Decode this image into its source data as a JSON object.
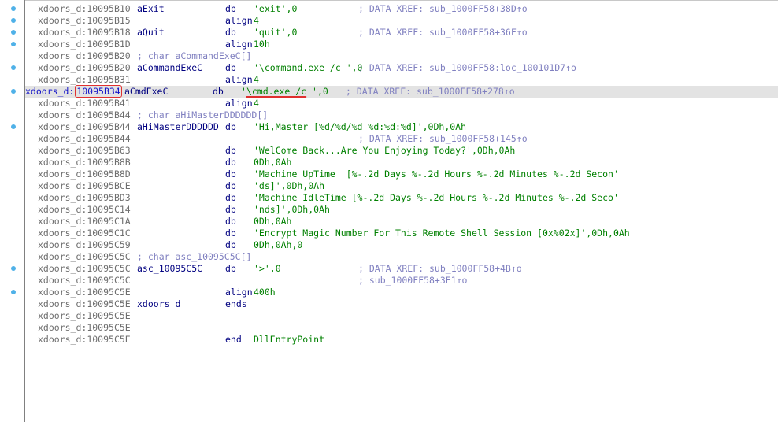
{
  "lines": [
    {
      "seg": "xdoors_d",
      "addr": "10095B10",
      "label": "aExit",
      "mnem": "db",
      "ops": "'exit',0",
      "cmt": "; DATA XREF: sub_1000FF58+38D↑o"
    },
    {
      "seg": "xdoors_d",
      "addr": "10095B15",
      "label": "",
      "mnem": "align",
      "ops": "4",
      "cmt": ""
    },
    {
      "seg": "xdoors_d",
      "addr": "10095B18",
      "label": "aQuit",
      "mnem": "db",
      "ops": "'quit',0",
      "cmt": "; DATA XREF: sub_1000FF58+36F↑o"
    },
    {
      "seg": "xdoors_d",
      "addr": "10095B1D",
      "label": "",
      "mnem": "align",
      "ops": "10h",
      "cmt": ""
    },
    {
      "seg": "xdoors_d",
      "addr": "10095B20",
      "decl": "; char aCommandExeC[]"
    },
    {
      "seg": "xdoors_d",
      "addr": "10095B20",
      "label": "aCommandExeC",
      "mnem": "db",
      "ops": "'\\command.exe /c ',0",
      "cmt": "; DATA XREF: sub_1000FF58:loc_100101D7↑o"
    },
    {
      "seg": "xdoors_d",
      "addr": "10095B31",
      "label": "",
      "mnem": "align",
      "ops": "4",
      "cmt": ""
    },
    {
      "seg": "xdoors_d",
      "addr": "10095B34",
      "label": "aCmdExeC",
      "mnem": "db",
      "ops_pre": "'",
      "ops_ul": "\\cmd.exe /c",
      "ops_post": " ',0",
      "cmt": "; DATA XREF: sub_1000FF58+278↑o",
      "current": true
    },
    {
      "seg": "xdoors_d",
      "addr": "10095B41",
      "label": "",
      "mnem": "align",
      "ops": "4",
      "cmt": ""
    },
    {
      "seg": "xdoors_d",
      "addr": "10095B44",
      "decl": "; char aHiMasterDDDDDD[]"
    },
    {
      "seg": "xdoors_d",
      "addr": "10095B44",
      "label": "aHiMasterDDDDDD",
      "mnem": "db",
      "ops": "'Hi,Master [%d/%d/%d %d:%d:%d]',0Dh,0Ah",
      "cmt": ""
    },
    {
      "seg": "xdoors_d",
      "addr": "10095B44",
      "label": "",
      "mnem": "",
      "ops": "",
      "cmt": "; DATA XREF: sub_1000FF58+145↑o"
    },
    {
      "seg": "xdoors_d",
      "addr": "10095B63",
      "label": "",
      "mnem": "db",
      "ops": "'WelCome Back...Are You Enjoying Today?',0Dh,0Ah",
      "cmt": ""
    },
    {
      "seg": "xdoors_d",
      "addr": "10095B8B",
      "label": "",
      "mnem": "db",
      "ops": "0Dh,0Ah",
      "cmt": ""
    },
    {
      "seg": "xdoors_d",
      "addr": "10095B8D",
      "label": "",
      "mnem": "db",
      "ops": "'Machine UpTime  [%-.2d Days %-.2d Hours %-.2d Minutes %-.2d Secon'",
      "cmt": ""
    },
    {
      "seg": "xdoors_d",
      "addr": "10095BCE",
      "label": "",
      "mnem": "db",
      "ops": "'ds]',0Dh,0Ah",
      "cmt": ""
    },
    {
      "seg": "xdoors_d",
      "addr": "10095BD3",
      "label": "",
      "mnem": "db",
      "ops": "'Machine IdleTime [%-.2d Days %-.2d Hours %-.2d Minutes %-.2d Seco'",
      "cmt": ""
    },
    {
      "seg": "xdoors_d",
      "addr": "10095C14",
      "label": "",
      "mnem": "db",
      "ops": "'nds]',0Dh,0Ah",
      "cmt": ""
    },
    {
      "seg": "xdoors_d",
      "addr": "10095C1A",
      "label": "",
      "mnem": "db",
      "ops": "0Dh,0Ah",
      "cmt": ""
    },
    {
      "seg": "xdoors_d",
      "addr": "10095C1C",
      "label": "",
      "mnem": "db",
      "ops": "'Encrypt Magic Number For This Remote Shell Session [0x%02x]',0Dh,0Ah",
      "cmt": ""
    },
    {
      "seg": "xdoors_d",
      "addr": "10095C59",
      "label": "",
      "mnem": "db",
      "ops": "0Dh,0Ah,0",
      "cmt": ""
    },
    {
      "seg": "xdoors_d",
      "addr": "10095C5C",
      "decl": "; char asc_10095C5C[]"
    },
    {
      "seg": "xdoors_d",
      "addr": "10095C5C",
      "label": "asc_10095C5C",
      "mnem": "db",
      "ops": "'>',0",
      "cmt": "; DATA XREF: sub_1000FF58+4B↑o"
    },
    {
      "seg": "xdoors_d",
      "addr": "10095C5C",
      "label": "",
      "mnem": "",
      "ops": "",
      "cmt": "; sub_1000FF58+3E1↑o"
    },
    {
      "seg": "xdoors_d",
      "addr": "10095C5E",
      "label": "",
      "mnem": "align",
      "ops": "400h",
      "cmt": ""
    },
    {
      "seg": "xdoors_d",
      "addr": "10095C5E",
      "label": "xdoors_d",
      "mnem": "ends",
      "ops": "",
      "cmt": ""
    },
    {
      "seg": "xdoors_d",
      "addr": "10095C5E",
      "label": "",
      "mnem": "",
      "ops": "",
      "cmt": ""
    },
    {
      "seg": "xdoors_d",
      "addr": "10095C5E",
      "label": "",
      "mnem": "",
      "ops": "",
      "cmt": ""
    },
    {
      "seg": "xdoors_d",
      "addr": "10095C5E",
      "label": "",
      "mnem": "end",
      "ops": "DllEntryPoint",
      "cmt": ""
    }
  ],
  "gutter_dots": [
    0,
    1,
    2,
    3,
    5,
    7,
    10,
    22,
    24
  ],
  "colors": {
    "address": "#6e6e6e",
    "current_address": "#1414c8",
    "label": "#000080",
    "operand": "#008000",
    "comment": "#8080c0",
    "highlight_row": "#e3e3e3",
    "marker_red": "#e03030",
    "breakpoint_dot": "#4fb1e8"
  }
}
